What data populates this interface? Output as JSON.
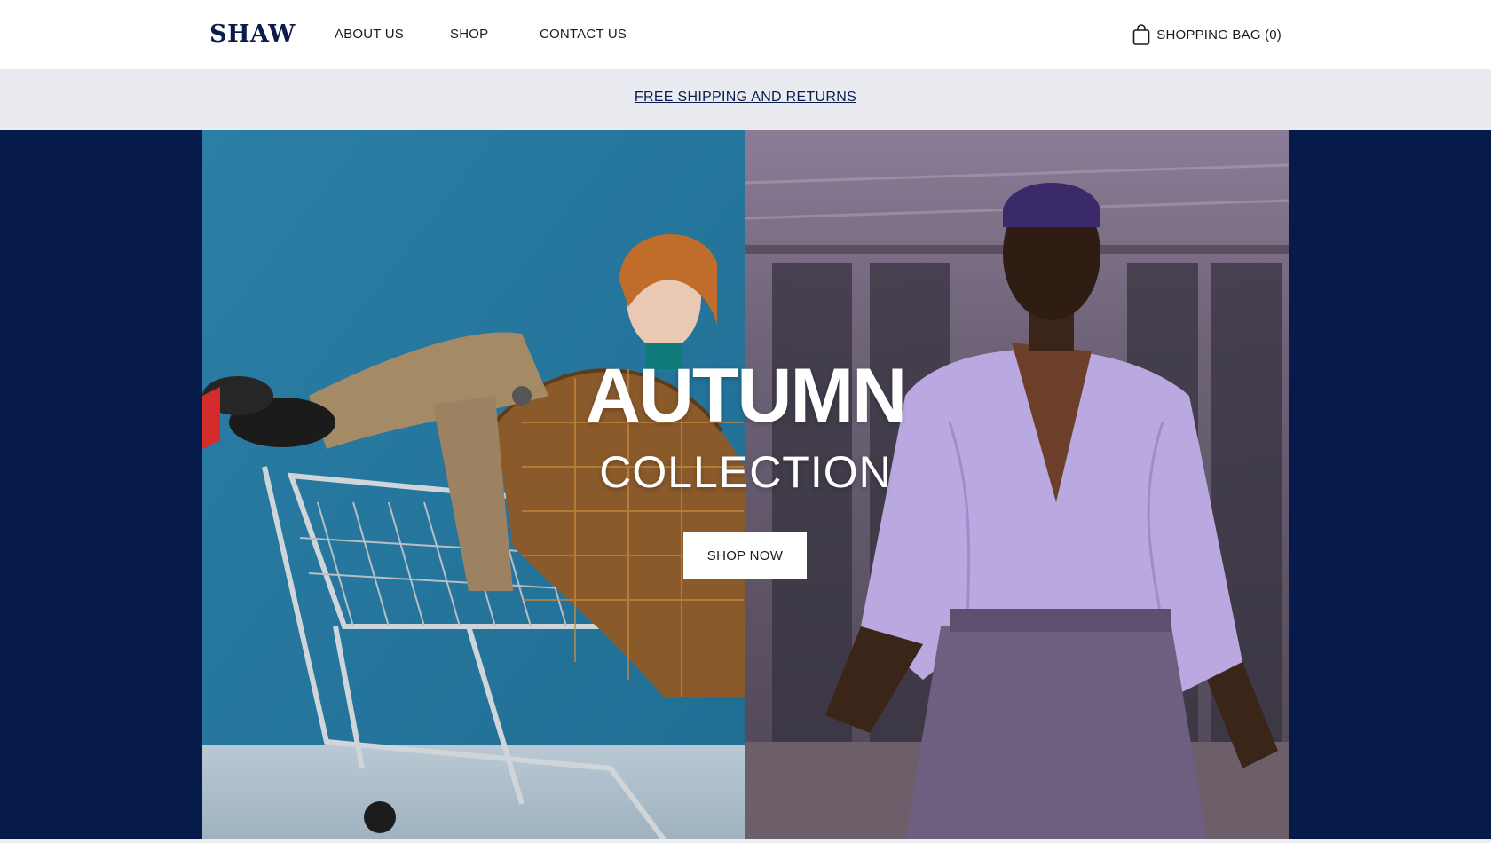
{
  "brand": {
    "logo_text": "SHAW"
  },
  "nav": {
    "items": [
      {
        "label": "ABOUT US"
      },
      {
        "label": "SHOP"
      },
      {
        "label": "CONTACT US"
      }
    ]
  },
  "cart": {
    "label": "SHOPPING BAG (0)"
  },
  "announcement": {
    "text": "FREE SHIPPING AND RETURNS"
  },
  "hero": {
    "title": "AUTUMN",
    "subtitle": "COLLECTION",
    "cta_label": "SHOP NOW"
  },
  "colors": {
    "brand_navy": "#0b1c4a",
    "hero_background": "#061b4a",
    "announcement_background": "#e9ebf0",
    "left_photo_backdrop": "#2f7fa6",
    "right_photo_shirt": "#b9a9e0"
  },
  "icons": {
    "cart_icon": "shopping-bag-icon"
  }
}
